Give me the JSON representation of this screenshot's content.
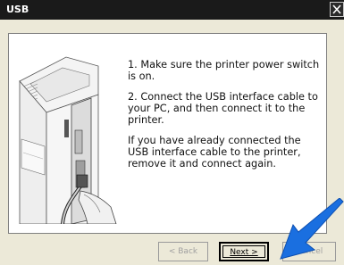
{
  "window": {
    "title": "USB",
    "close_icon": "close-icon"
  },
  "instructions": [
    "1. Make sure the printer power switch is on.",
    "2. Connect the USB interface cable to your PC, and then connect it to the printer.",
    "If you have already connected the USB interface cable to the printer, remove it and connect again."
  ],
  "buttons": {
    "back": "< Back",
    "next": "Next >",
    "cancel": "Cancel"
  },
  "colors": {
    "arrow": "#1a6fe0",
    "titlebar": "#1a1a1a"
  }
}
